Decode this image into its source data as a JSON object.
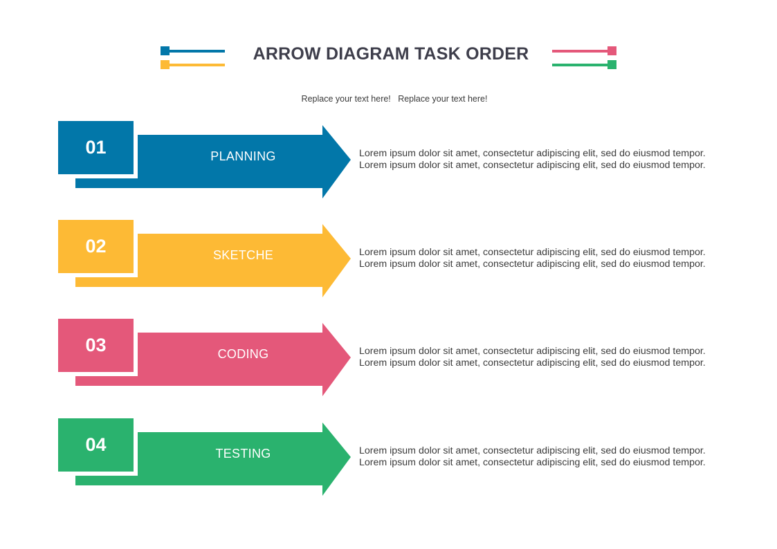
{
  "header": {
    "title": "ARROW DIAGRAM TASK ORDER",
    "subtitle": "Replace your text here!   Replace your text here!"
  },
  "decorations": {
    "left": [
      {
        "color": "#0277A9"
      },
      {
        "color": "#FDBA35"
      }
    ],
    "right": [
      {
        "color": "#E4587A"
      },
      {
        "color": "#2AB26E"
      }
    ]
  },
  "steps": [
    {
      "number": "01",
      "label": "PLANNING",
      "color": "#0277A9",
      "lines": [
        "Lorem ipsum dolor sit amet, consectetur adipiscing elit, sed do eiusmod tempor.",
        "Lorem ipsum dolor sit amet, consectetur adipiscing elit, sed do eiusmod tempor."
      ]
    },
    {
      "number": "02",
      "label": "SKETCHE",
      "color": "#FDBA35",
      "lines": [
        "Lorem ipsum dolor sit amet, consectetur adipiscing elit, sed do eiusmod tempor.",
        "Lorem ipsum dolor sit amet, consectetur adipiscing elit, sed do eiusmod tempor."
      ]
    },
    {
      "number": "03",
      "label": "CODING",
      "color": "#E4587A",
      "lines": [
        "Lorem ipsum dolor sit amet, consectetur adipiscing elit, sed do eiusmod tempor.",
        "Lorem ipsum dolor sit amet, consectetur adipiscing elit, sed do eiusmod tempor."
      ]
    },
    {
      "number": "04",
      "label": "TESTING",
      "color": "#2AB26E",
      "lines": [
        "Lorem ipsum dolor sit amet, consectetur adipiscing elit, sed do eiusmod tempor.",
        "Lorem ipsum dolor sit amet, consectetur adipiscing elit, sed do eiusmod tempor."
      ]
    }
  ]
}
